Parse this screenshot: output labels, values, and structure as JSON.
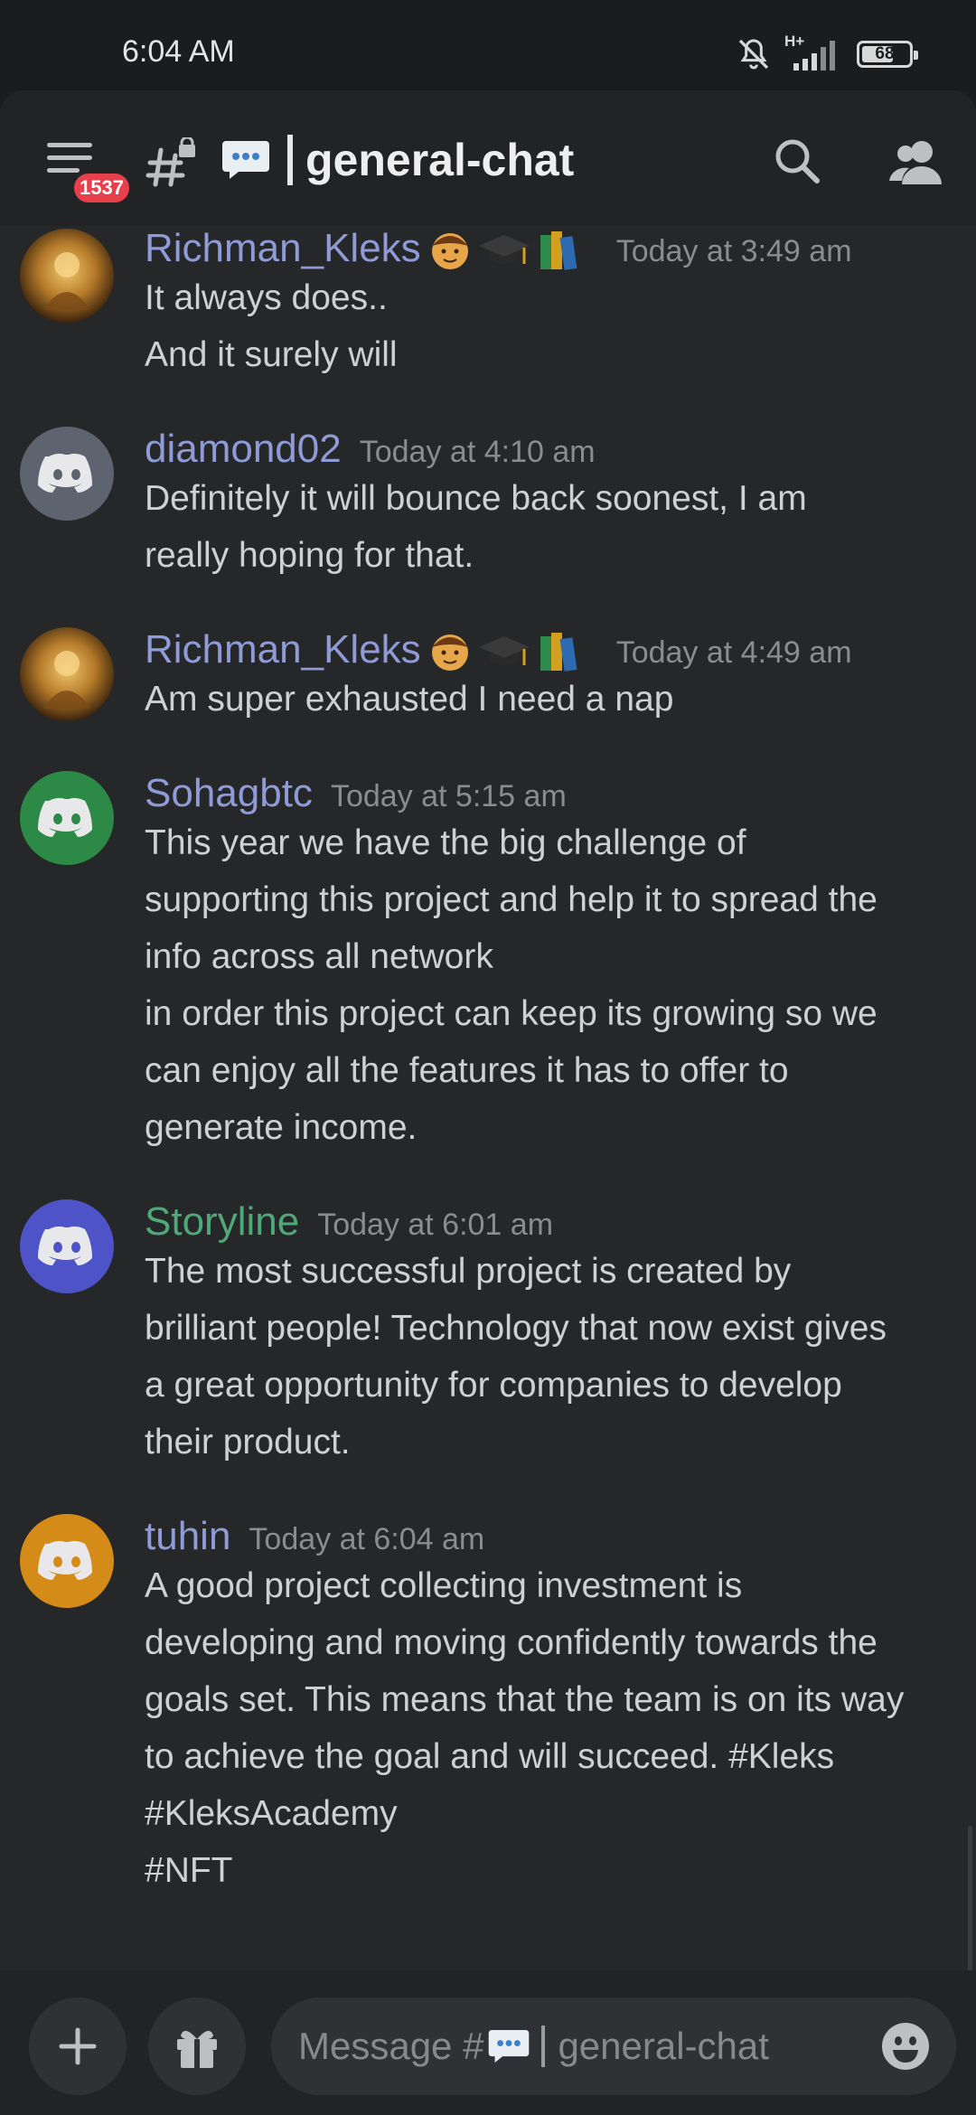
{
  "status_bar": {
    "time": "6:04 AM",
    "network": "H+",
    "battery": "68",
    "battery_level": 0.68,
    "icons": [
      "bell-off-icon",
      "signal-icon",
      "battery-icon"
    ]
  },
  "header": {
    "notification_badge": "1537",
    "channel_name": "general-chat",
    "icons": [
      "menu-icon",
      "locked-hashtag-icon",
      "speech-bubble-emoji",
      "search-icon",
      "members-icon"
    ]
  },
  "messages": [
    {
      "author": "Richman_Kleks",
      "author_color": "#8e9bd6",
      "avatar": "gold-avatar",
      "decor": [
        "man-emoji",
        "graduation-cap-emoji",
        "books-emoji"
      ],
      "time": "Today at 3:49 am",
      "lines": [
        "It always does..",
        "And it surely will"
      ]
    },
    {
      "author": "diamond02",
      "author_color": "#8e9bd6",
      "avatar": "discord-grey",
      "avatar_color": "#747f8d",
      "time": "Today at 4:10 am",
      "lines": [
        "Definitely it will bounce back soonest, I am",
        "really hoping for that."
      ]
    },
    {
      "author": "Richman_Kleks",
      "author_color": "#8e9bd6",
      "avatar": "gold-avatar",
      "decor": [
        "man-emoji",
        "graduation-cap-emoji",
        "books-emoji"
      ],
      "time": "Today at 4:49 am",
      "lines": [
        "Am super exhausted I need a nap"
      ]
    },
    {
      "author": "Sohagbtc",
      "author_color": "#8e9bd6",
      "avatar": "discord-green",
      "avatar_color": "#2d8a46",
      "time": "Today at 5:15 am",
      "lines": [
        "This year we have the big challenge of",
        "supporting this project and help it to spread the",
        "info across all network",
        "in order this project can keep its growing so we",
        "can enjoy all the features it has to offer to",
        "generate income."
      ]
    },
    {
      "author": "Storyline",
      "author_color": "#4fa878",
      "avatar": "discord-blurple",
      "avatar_color": "#4e54c8",
      "time": "Today at 6:01 am",
      "lines": [
        "The most successful project is created by",
        "brilliant people! Technology that now exist gives",
        "a great opportunity for companies to develop",
        "their product."
      ]
    },
    {
      "author": "tuhin",
      "author_color": "#8e9bd6",
      "avatar": "discord-orange",
      "avatar_color": "#d58b17",
      "time": "Today at 6:04 am",
      "lines": [
        "A good project collecting investment is",
        "developing and moving confidently towards the",
        "goals set. This means that the team is on its way",
        "to achieve the goal and will succeed. #Kleks",
        "#KleksAcademy",
        "#NFT"
      ]
    }
  ],
  "composer": {
    "placeholder_prefix": "Message #",
    "placeholder_channel": "general-chat",
    "icons": [
      "plus-icon",
      "gift-icon",
      "emoji-icon"
    ]
  }
}
